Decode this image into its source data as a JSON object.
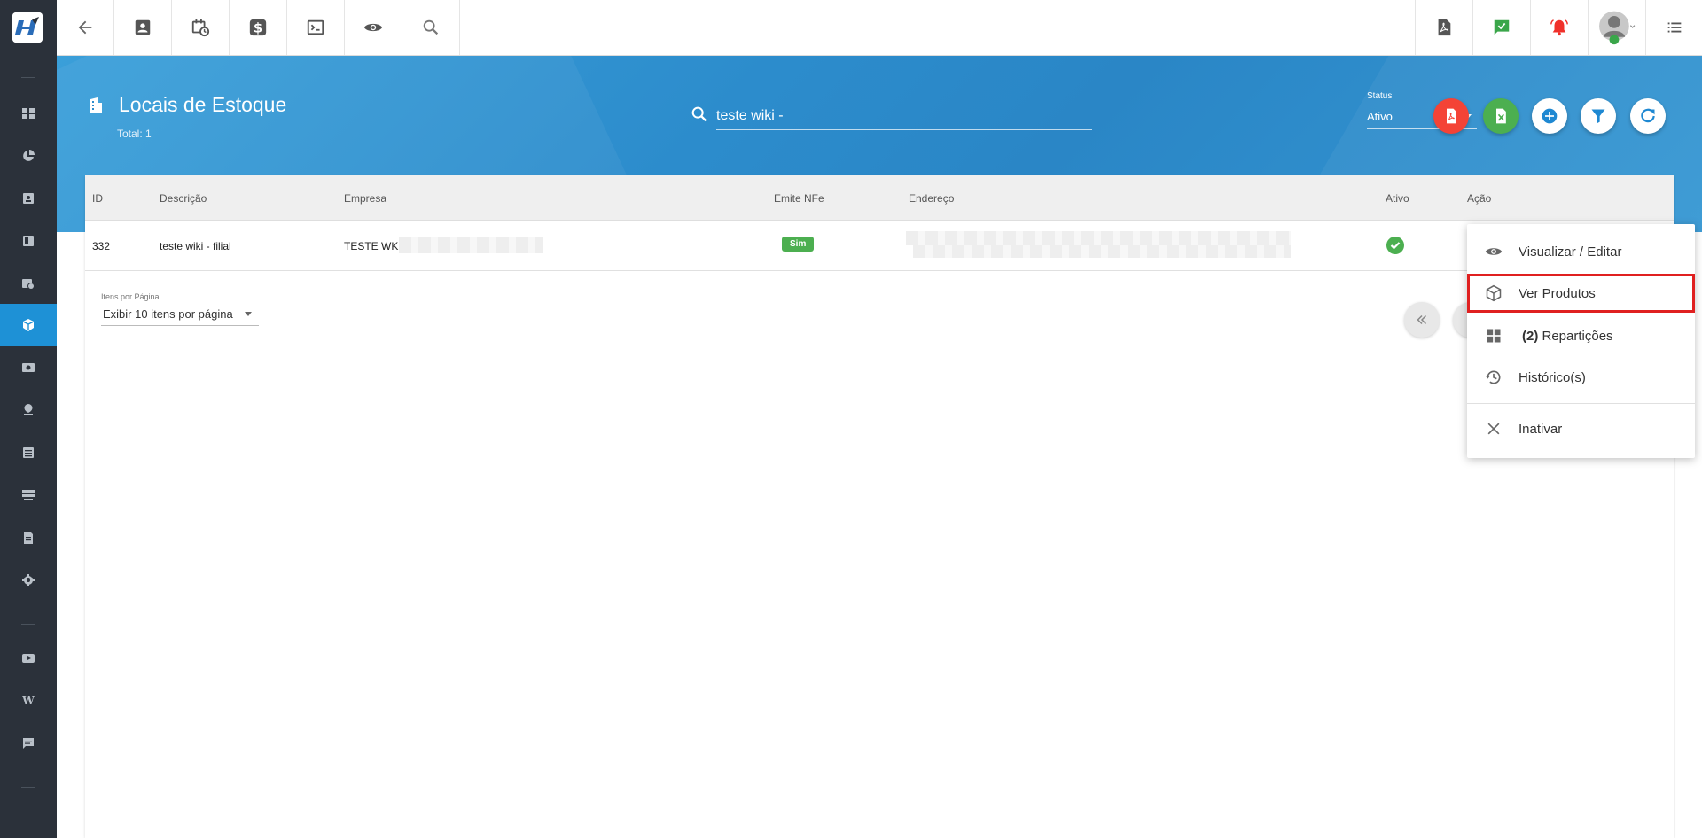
{
  "header": {
    "title": "Locais de Estoque",
    "total": "Total: 1",
    "search_value": "teste wiki -",
    "status_label": "Status",
    "status_value": "Ativo"
  },
  "table": {
    "columns": [
      "ID",
      "Descrição",
      "Empresa",
      "Emite NFe",
      "Endereço",
      "Ativo",
      "Ação"
    ],
    "rows": [
      {
        "id": "332",
        "descricao": "teste wiki - filial",
        "empresa": "TESTE WK",
        "emite_nfe": "Sim"
      }
    ]
  },
  "pagination": {
    "per_page_label": "Itens por Página",
    "per_page_value": "Exibir 10 itens por página"
  },
  "action_menu": {
    "items": [
      {
        "label": "Visualizar / Editar",
        "icon": "eye-icon"
      },
      {
        "label": "Ver Produtos",
        "icon": "cube-icon"
      },
      {
        "count": "(2)",
        "label": " Repartições",
        "icon": "grid-icon"
      },
      {
        "label": "Histórico(s)",
        "icon": "history-icon"
      },
      {
        "label": "Inativar",
        "icon": "close-icon"
      }
    ]
  },
  "colors": {
    "header_blue": "#2c8ccc",
    "sidebar": "#2b313a",
    "sidebar_active": "#1e91d6",
    "pdf_red": "#f44336",
    "excel_green": "#4caf50",
    "highlight": "#e02020"
  }
}
